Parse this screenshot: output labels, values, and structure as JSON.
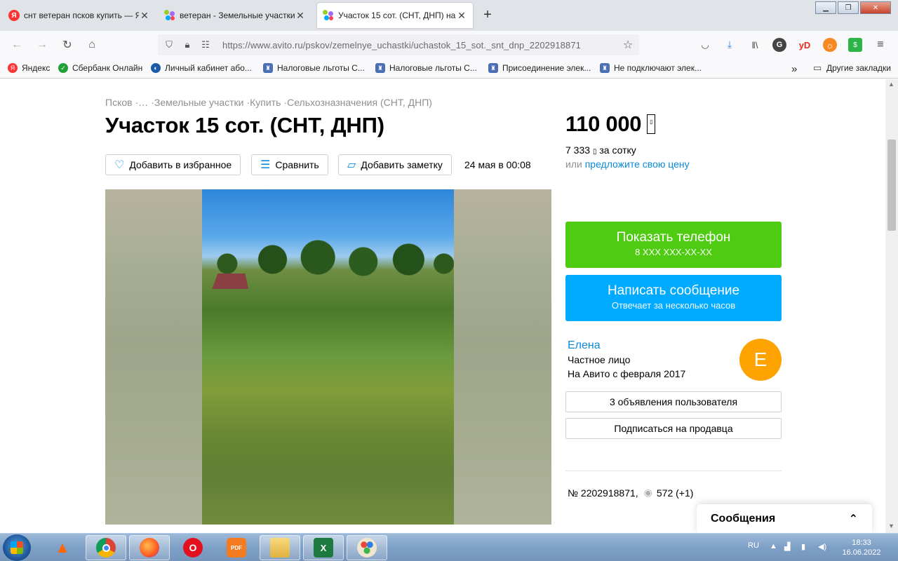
{
  "browser": {
    "tabs": [
      {
        "title": "снт ветеран псков купить — Ян",
        "favicon": "yandex-icon"
      },
      {
        "title": "ветеран - Земельные участки",
        "favicon": "avito-icon"
      },
      {
        "title": "Участок 15 сот. (СНТ, ДНП) на",
        "favicon": "avito-icon"
      }
    ],
    "active_tab": 2,
    "url": "https://www.avito.ru/pskov/zemelnye_uchastki/uchastok_15_sot._snt_dnp_2202918871",
    "bookmarks": [
      "Яндекс",
      "Сбербанк Онлайн",
      "Личный кабинет або...",
      "Налоговые льготы С...",
      "Налоговые льготы С...",
      "Присоединение элек...",
      "Не подключают элек..."
    ],
    "other_bookmarks": "Другие закладки",
    "ext_g": "G",
    "ext_yd": "yD"
  },
  "breadcrumbs": [
    "Псков",
    "…",
    "Земельные участки",
    "Купить",
    "Сельхозназначения (СНТ, ДНП)"
  ],
  "breadcrumb_separator": "·",
  "listing": {
    "title": "Участок 15 сот. (СНТ, ДНП)",
    "price": "110 000",
    "price_per_unit": "7 333",
    "price_per_suffix": "за сотку",
    "offer_prefix": "или",
    "offer_link": "предложите свою цену",
    "date": "24 мая в 00:08",
    "id": "№ 2202918871,",
    "views": "572 (+1)"
  },
  "actions": {
    "favorite": "Добавить в избранное",
    "compare": "Сравнить",
    "note": "Добавить заметку"
  },
  "contact": {
    "phone_title": "Показать телефон",
    "phone_masked": "8 XXX XXX-XX-XX",
    "message_title": "Написать сообщение",
    "message_sub": "Отвечает за несколько часов"
  },
  "seller": {
    "name": "Елена",
    "type": "Частное лицо",
    "since": "На Авито с февраля 2017",
    "avatar_letter": "Е",
    "ads_button": "3 объявления пользователя",
    "subscribe_button": "Подписаться на продавца"
  },
  "messages": {
    "title": "Сообщения"
  },
  "taskbar": {
    "lang": "RU",
    "time": "18:33",
    "date": "16.06.2022"
  },
  "colors": {
    "phone_button": "#4fcc12",
    "message_button": "#00aaff",
    "link": "#0a8ad8",
    "avatar": "#ffa300"
  }
}
